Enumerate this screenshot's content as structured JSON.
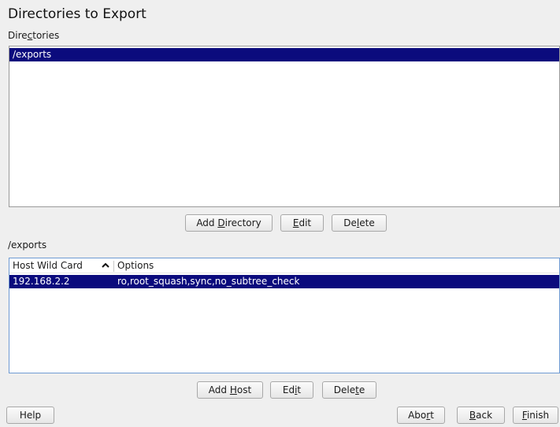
{
  "title": "Directories to Export",
  "directories": {
    "label_pre": "Dire",
    "label_acc": "c",
    "label_post": "tories",
    "items": [
      "/exports"
    ],
    "buttons": {
      "add": {
        "pre": "Add ",
        "acc": "D",
        "post": "irectory"
      },
      "edit": {
        "pre": "",
        "acc": "E",
        "post": "dit"
      },
      "delete": {
        "pre": "De",
        "acc": "l",
        "post": "ete"
      }
    }
  },
  "hosts": {
    "label": "/exports",
    "columns": {
      "host": "Host Wild Card",
      "options": "Options"
    },
    "sort_icon": "chevron-up-icon",
    "rows": [
      {
        "host": "192.168.2.2",
        "options": "ro,root_squash,sync,no_subtree_check"
      }
    ],
    "buttons": {
      "add": {
        "pre": "Add ",
        "acc": "H",
        "post": "ost"
      },
      "edit": {
        "pre": "Ed",
        "acc": "i",
        "post": "t"
      },
      "delete": {
        "pre": "Dele",
        "acc": "t",
        "post": "e"
      }
    }
  },
  "footer": {
    "help": "Help",
    "abort": {
      "pre": "Abo",
      "acc": "r",
      "post": "t"
    },
    "back": {
      "pre": "",
      "acc": "B",
      "post": "ack"
    },
    "finish": {
      "pre": "",
      "acc": "F",
      "post": "inish"
    }
  },
  "colors": {
    "selection": "#0b0b7d",
    "focus_border": "#6f9bd3"
  }
}
